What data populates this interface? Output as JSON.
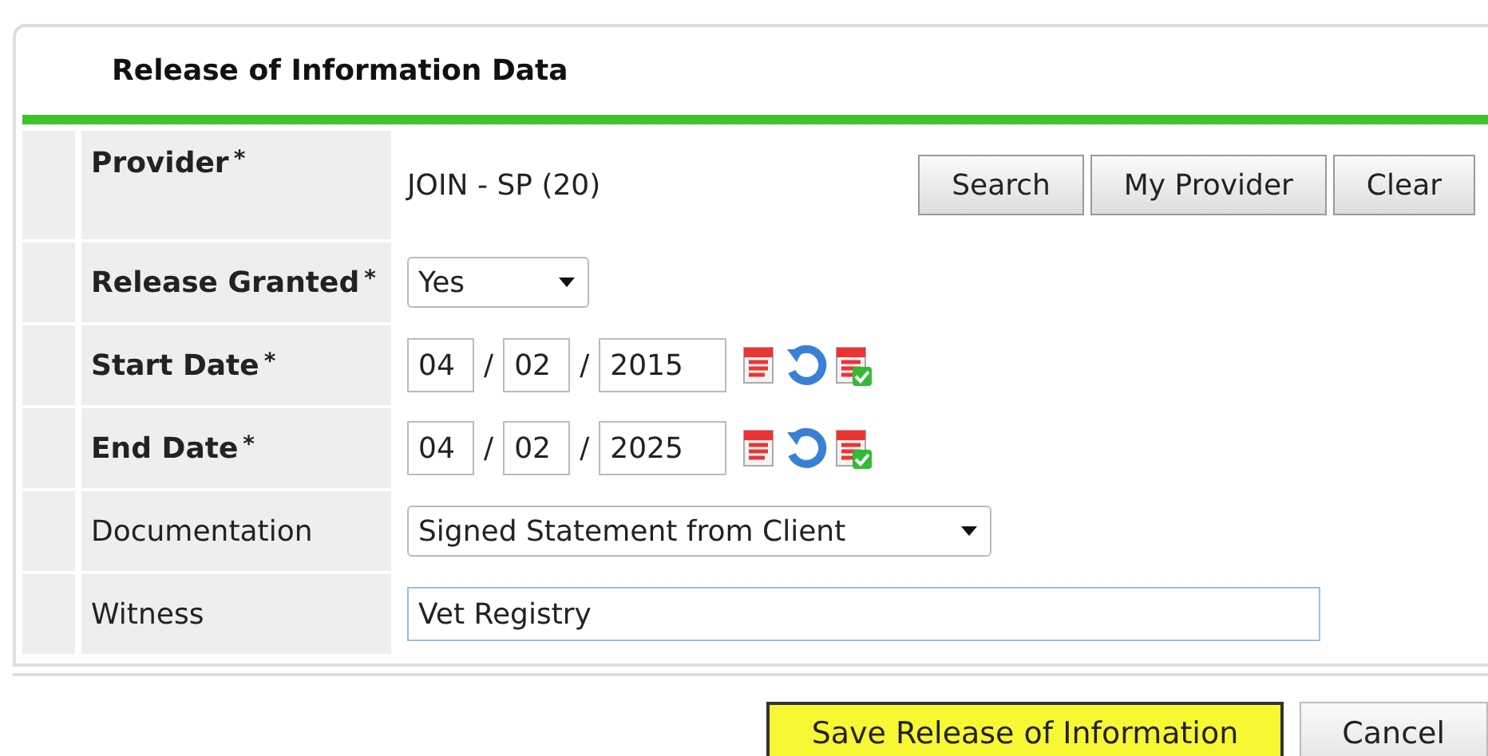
{
  "panel": {
    "title": "Release of Information Data"
  },
  "rows": [
    {
      "kind": "provider",
      "label": "Provider",
      "required": true,
      "value": "JOIN - SP (20)",
      "buttons": [
        "Search",
        "My Provider",
        "Clear"
      ]
    },
    {
      "kind": "select",
      "label": "Release Granted",
      "required": true,
      "value": "Yes"
    },
    {
      "kind": "date",
      "label": "Start Date",
      "required": true,
      "month": "04",
      "day": "02",
      "year": "2015",
      "separator": "/"
    },
    {
      "kind": "date",
      "label": "End Date",
      "required": true,
      "month": "04",
      "day": "02",
      "year": "2025",
      "separator": "/"
    },
    {
      "kind": "select",
      "label": "Documentation",
      "required": false,
      "value": "Signed Statement from Client"
    },
    {
      "kind": "input",
      "label": "Witness",
      "required": false,
      "value": "Vet Registry"
    }
  ],
  "required_mark": "*",
  "actions": [
    {
      "label": "Save Release of Information",
      "primary": true
    },
    {
      "label": "Cancel",
      "primary": false
    }
  ]
}
